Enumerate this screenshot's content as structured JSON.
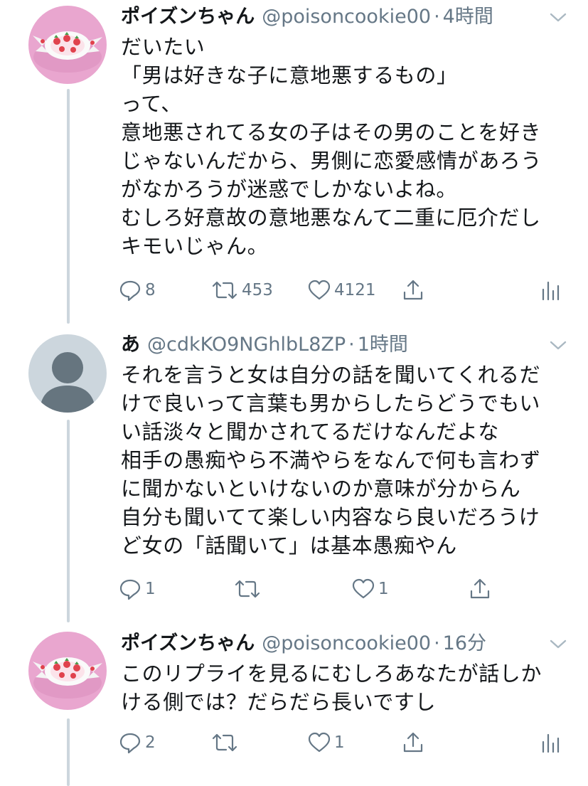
{
  "tweets": [
    {
      "name": "ポイズンちゃん",
      "handle": "@poisoncookie00",
      "time": "4時間",
      "lines": [
        "だいたい",
        "「男は好きな子に意地悪するもの」",
        "って、",
        "意地悪されてる女の子はその男のことを好き",
        "じゃないんだから、男側に恋愛感情があろう",
        "がなかろうが迷惑でしかないよね。",
        "むしろ好意故の意地悪なんて二重に厄介だし",
        "キモいじゃん。"
      ],
      "replies": "8",
      "retweets": "453",
      "likes": "4121",
      "avatar": "strawberry-candy"
    },
    {
      "name": "あ",
      "handle": "@cdkKO9NGhlbL8ZP",
      "time": "1時間",
      "lines": [
        "それを言うと女は自分の話を聞いてくれるだ",
        "けで良いって言葉も男からしたらどうでもい",
        "い話淡々と聞かされてるだけなんだよな",
        "相手の愚痴やら不満やらをなんで何も言わず",
        "に聞かないといけないのか意味が分からん",
        "自分も聞いてて楽しい内容なら良いだろうけ",
        "ど女の「話聞いて」は基本愚痴やん"
      ],
      "replies": "1",
      "retweets": "",
      "likes": "1",
      "avatar": "default-profile"
    },
    {
      "name": "ポイズンちゃん",
      "handle": "@poisoncookie00",
      "time": "16分",
      "lines": [
        "このリプライを見るにむしろあなたが話しか",
        "ける側では？だらだら長いですし"
      ],
      "replies": "2",
      "retweets": "",
      "likes": "1",
      "avatar": "strawberry-candy"
    }
  ],
  "icons": {
    "reply": "reply-icon",
    "retweet": "retweet-icon",
    "like": "heart-icon",
    "share": "share-icon",
    "analytics": "analytics-icon",
    "caret": "chevron-down-icon"
  },
  "colors": {
    "text": "#14171a",
    "secondary": "#657786",
    "thread_line": "#ccd6dd",
    "avatar_pink": "#e9a6cf",
    "default_avatar_bg": "#ccd6dd",
    "default_avatar_fg": "#66757f"
  }
}
